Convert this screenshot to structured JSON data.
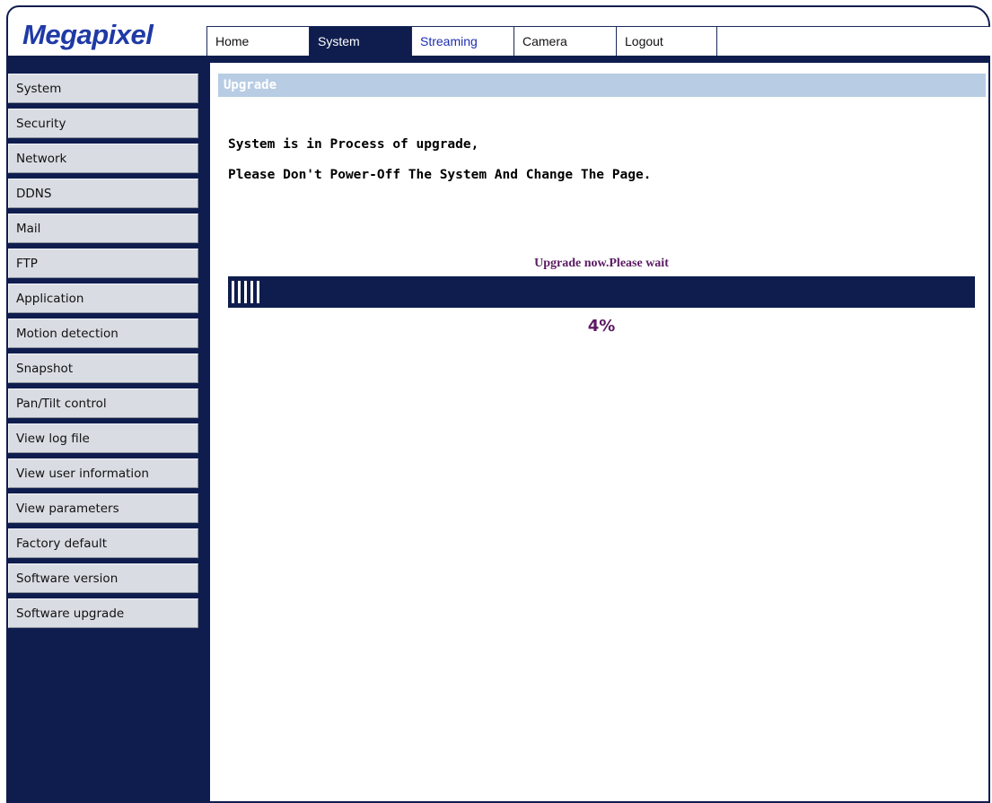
{
  "brand": {
    "logo_text": "Megapixel"
  },
  "nav": {
    "tabs": [
      {
        "label": "Home",
        "active": false
      },
      {
        "label": "System",
        "active": true
      },
      {
        "label": "Streaming",
        "active": false
      },
      {
        "label": "Camera",
        "active": false
      },
      {
        "label": "Logout",
        "active": false
      }
    ]
  },
  "sidebar": {
    "items": [
      {
        "label": "System"
      },
      {
        "label": "Security"
      },
      {
        "label": "Network"
      },
      {
        "label": "DDNS"
      },
      {
        "label": "Mail"
      },
      {
        "label": "FTP"
      },
      {
        "label": "Application"
      },
      {
        "label": "Motion detection"
      },
      {
        "label": "Snapshot"
      },
      {
        "label": "Pan/Tilt control"
      },
      {
        "label": "View log file"
      },
      {
        "label": "View user information"
      },
      {
        "label": "View parameters"
      },
      {
        "label": "Factory default"
      },
      {
        "label": "Software version"
      },
      {
        "label": "Software upgrade"
      }
    ]
  },
  "main": {
    "section_title": "Upgrade",
    "message_line1": "System is in Process of upgrade,",
    "message_line2": "Please Don't Power-Off The System And Change The Page.",
    "progress": {
      "label": "Upgrade now.Please wait",
      "percent_text": "4%",
      "value": 0.04
    }
  },
  "colors": {
    "navy": "#0f1d4e",
    "header_bar": "#b8cce4",
    "sidebar_button": "#d9dde3",
    "progress_text": "#5b1b63",
    "logo": "#1f3aa6",
    "link": "#1d2fb1"
  }
}
